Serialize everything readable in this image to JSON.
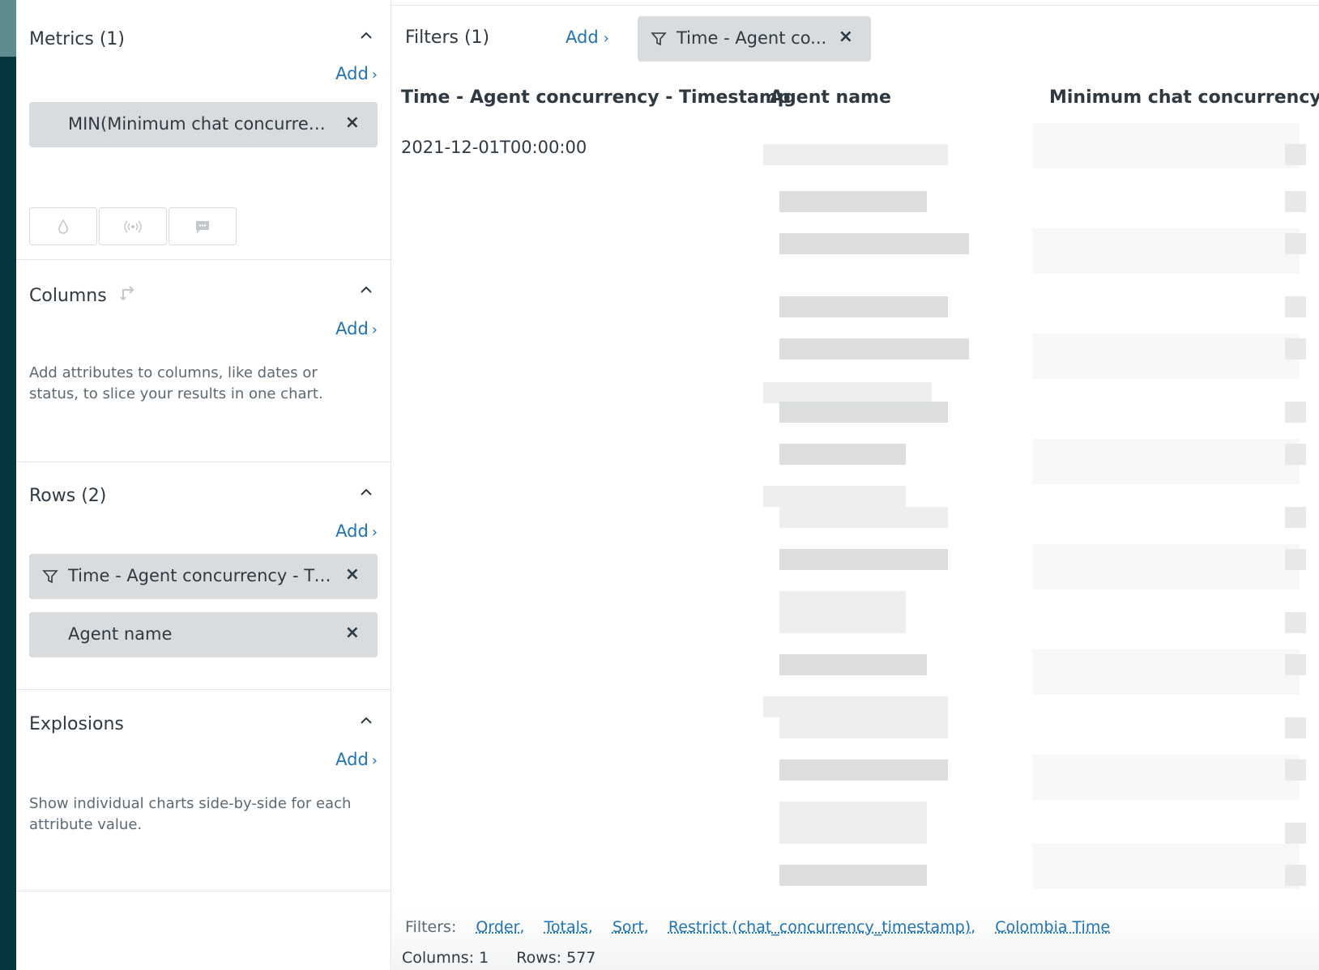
{
  "sidebar": {
    "metrics": {
      "title": "Metrics (1)",
      "add_label": "Add",
      "pill_label": "MIN(Minimum chat concurrency)"
    },
    "columns": {
      "title": "Columns",
      "add_label": "Add",
      "help": "Add attributes to columns, like dates or status, to slice your results in one chart."
    },
    "rows": {
      "title": "Rows (2)",
      "add_label": "Add",
      "pills": [
        "Time - Agent concurrency - Timestamp",
        "Agent name"
      ]
    },
    "explosions": {
      "title": "Explosions",
      "add_label": "Add",
      "help": "Show individual charts side-by-side for each attribute value."
    },
    "icon_buttons": [
      "drop-icon",
      "broadcast-icon",
      "chat-icon"
    ]
  },
  "main": {
    "filters_label": "Filters (1)",
    "filters_add": "Add",
    "filter_pill": "Time - Agent co...",
    "table": {
      "headers": [
        "Time - Agent concurrency - Timestamp",
        "Agent name",
        "Minimum chat concurrency"
      ],
      "first_row_timestamp": "2021-12-01T00:00:00"
    }
  },
  "footer": {
    "filters_label": "Filters:",
    "filter_links": [
      "Order,",
      "Totals,",
      "Sort,",
      "Restrict (chat_concurrency_timestamp),",
      "Colombia Time"
    ],
    "columns_count": "Columns: 1",
    "rows_count": "Rows: 577"
  },
  "colors": {
    "rail": "#03363d",
    "link": "#1f73b7",
    "pill": "#d8dcde"
  }
}
